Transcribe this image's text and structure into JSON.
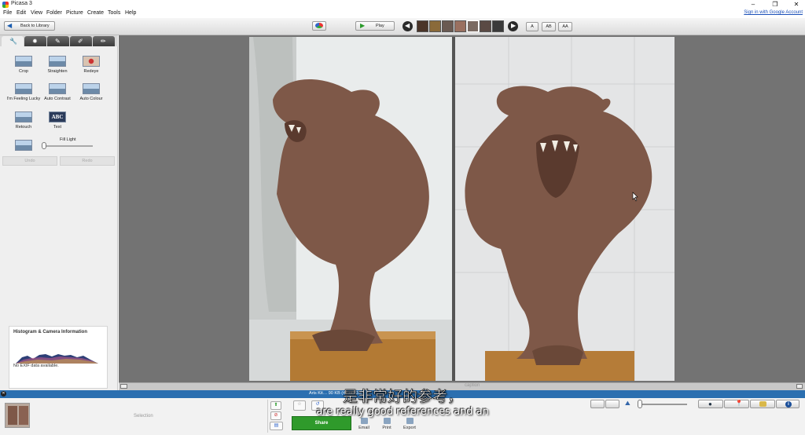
{
  "app": {
    "title": "Picasa 3",
    "sign_in": "Sign in with Google Account"
  },
  "window_controls": [
    "–",
    "❐",
    "✕"
  ],
  "menu": [
    "File",
    "Edit",
    "View",
    "Folder",
    "Picture",
    "Create",
    "Tools",
    "Help"
  ],
  "toolbar": {
    "back_label": "Back to Library",
    "play_label": "Play",
    "caption_size_options": [
      "A",
      "AB",
      "AA"
    ]
  },
  "edit_tabs": [
    "wrench-icon",
    "sun-icon",
    "brush-icon",
    "pencil-icon",
    "paint-icon"
  ],
  "tools": [
    {
      "label": "Crop"
    },
    {
      "label": "Straighten"
    },
    {
      "label": "Redeye"
    },
    {
      "label": "I'm Feeling Lucky"
    },
    {
      "label": "Auto Contrast"
    },
    {
      "label": "Auto Colour"
    },
    {
      "label": "Retouch"
    },
    {
      "label": "Text"
    }
  ],
  "fill_light": {
    "label": "Fill Light",
    "value": 0
  },
  "history": {
    "undo": "Undo",
    "redo": "Redo"
  },
  "histogram": {
    "title": "Histogram & Camera Information",
    "no_exif": "No EXIF data available."
  },
  "caption": {
    "placeholder": "caption"
  },
  "status": {
    "text": "Arts Kit… 90 KB   (47 of 223)"
  },
  "tray": {
    "selection_label": "Selection",
    "share_label": "Share",
    "actions": [
      "Email",
      "Print",
      "Export"
    ]
  },
  "subtitles": {
    "chinese": "是非常好的参考，",
    "english": "are really good references and an"
  },
  "colors": {
    "status_bar": "#2b6fb0",
    "share_button": "#2f9a2b",
    "viewer_bg": "#737373"
  }
}
